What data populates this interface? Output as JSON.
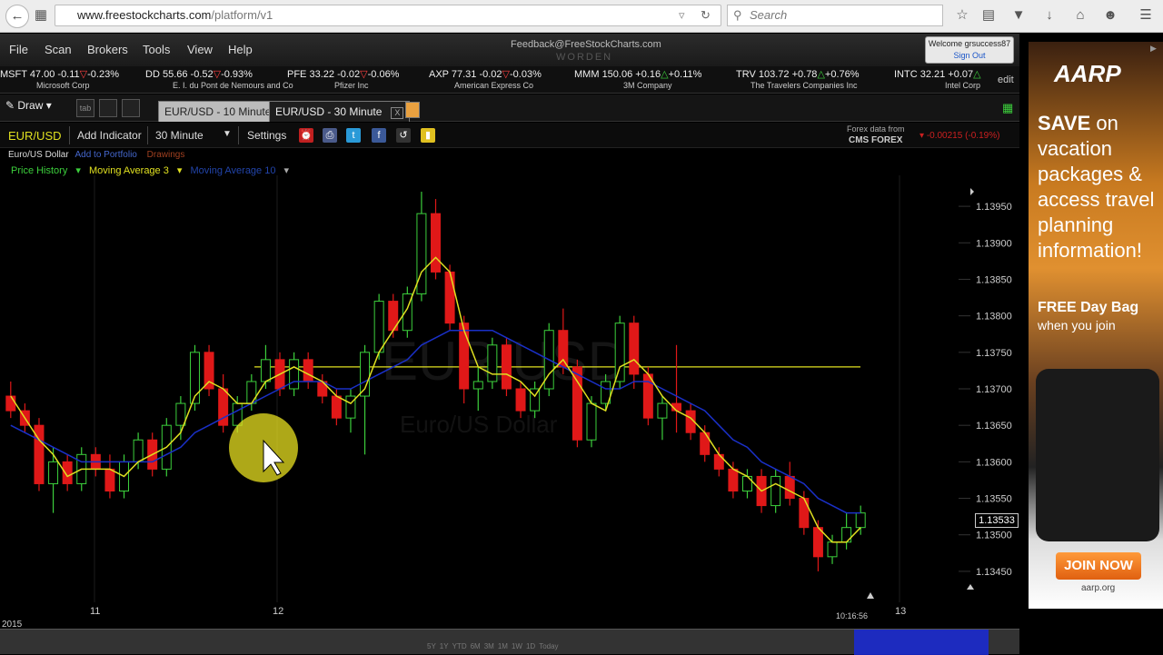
{
  "browser": {
    "url_host": "www.freestockcharts.com",
    "url_path": "/platform/v1",
    "search_placeholder": "Search"
  },
  "menu": {
    "items": [
      "File",
      "Scan",
      "Brokers",
      "Tools",
      "View",
      "Help"
    ],
    "feedback": "Feedback@FreeStockCharts.com",
    "worden": "WORDEN",
    "welcome": "Welcome grsuccess87",
    "sign_out": "Sign Out"
  },
  "ticker": {
    "items": [
      {
        "sym": "MSFT",
        "price": "47.00",
        "chg": "-0.11",
        "pct": "-0.23%",
        "dir": "down",
        "co": "Microsoft Corp"
      },
      {
        "sym": "DD",
        "price": "55.66",
        "chg": "-0.52",
        "pct": "-0.93%",
        "dir": "down",
        "co": "E. I. du Pont de Nemours and Co"
      },
      {
        "sym": "PFE",
        "price": "33.22",
        "chg": "-0.02",
        "pct": "-0.06%",
        "dir": "down",
        "co": "Pfizer Inc"
      },
      {
        "sym": "AXP",
        "price": "77.31",
        "chg": "-0.02",
        "pct": "-0.03%",
        "dir": "down",
        "co": "American Express Co"
      },
      {
        "sym": "MMM",
        "price": "150.06",
        "chg": "+0.16",
        "pct": "+0.11%",
        "dir": "up",
        "co": "3M Company"
      },
      {
        "sym": "TRV",
        "price": "103.72",
        "chg": "+0.78",
        "pct": "+0.76%",
        "dir": "up",
        "co": "The Travelers Companies Inc"
      },
      {
        "sym": "INTC",
        "price": "32.21",
        "chg": "+0.07",
        "pct": "",
        "dir": "up",
        "co": "Intel Corp"
      }
    ],
    "edit": "edit"
  },
  "toolbar": {
    "draw": "Draw",
    "tab_label": "tab",
    "tabs": [
      "EUR/USD - 10 Minute",
      "EUR/USD - 30 Minute"
    ],
    "tab_close": "X"
  },
  "chart_header": {
    "symbol": "EUR/USD",
    "add_indicator": "Add Indicator",
    "interval": "30 Minute",
    "settings": "Settings",
    "forex_from": "Forex data from",
    "provider": "CMS FOREX",
    "change": "-0.00215 (-0.19%)",
    "name": "Euro/US Dollar",
    "add_portfolio": "Add to Portfolio",
    "drawings": "Drawings"
  },
  "legend": {
    "price": "Price History",
    "ma3": "Moving Average 3",
    "ma10": "Moving Average 10"
  },
  "colors": {
    "up": "#3ccf3c",
    "down": "#e01818",
    "ma3": "#e0e020",
    "ma10": "#1a30c8",
    "hline": "#e0e020"
  },
  "chart_data": {
    "type": "candlestick",
    "ylim": [
      1.1342,
      1.1398
    ],
    "y_ticks": [
      "1.13950",
      "1.13900",
      "1.13850",
      "1.13800",
      "1.13750",
      "1.13700",
      "1.13650",
      "1.13600",
      "1.13550",
      "1.13500",
      "1.13450"
    ],
    "y_tick_values": [
      1.1395,
      1.139,
      1.1385,
      1.138,
      1.1375,
      1.137,
      1.1365,
      1.136,
      1.1355,
      1.135,
      1.1345
    ],
    "x_labels": [
      "11",
      "12",
      "13"
    ],
    "last_price": "1.13533",
    "horizontal_line": 1.1373,
    "candles": [
      [
        1.1369,
        1.1371,
        1.1366,
        1.1367
      ],
      [
        1.1367,
        1.1368,
        1.1364,
        1.1365
      ],
      [
        1.1365,
        1.1366,
        1.1356,
        1.1357
      ],
      [
        1.1357,
        1.1362,
        1.1353,
        1.136
      ],
      [
        1.136,
        1.1361,
        1.1356,
        1.1357
      ],
      [
        1.1357,
        1.1362,
        1.1356,
        1.1361
      ],
      [
        1.1361,
        1.1362,
        1.1358,
        1.1359
      ],
      [
        1.1359,
        1.1361,
        1.1355,
        1.1356
      ],
      [
        1.1356,
        1.1361,
        1.1355,
        1.136
      ],
      [
        1.136,
        1.1364,
        1.1359,
        1.1363
      ],
      [
        1.1363,
        1.1364,
        1.1358,
        1.1359
      ],
      [
        1.1359,
        1.1366,
        1.1358,
        1.1365
      ],
      [
        1.1365,
        1.1369,
        1.1363,
        1.1368
      ],
      [
        1.1368,
        1.1376,
        1.1367,
        1.1375
      ],
      [
        1.1375,
        1.1376,
        1.1369,
        1.137
      ],
      [
        1.137,
        1.1372,
        1.1364,
        1.1365
      ],
      [
        1.1365,
        1.1369,
        1.1364,
        1.1368
      ],
      [
        1.1368,
        1.1372,
        1.1367,
        1.1371
      ],
      [
        1.1371,
        1.1376,
        1.137,
        1.1374
      ],
      [
        1.1374,
        1.1375,
        1.1369,
        1.137
      ],
      [
        1.137,
        1.1375,
        1.1369,
        1.1374
      ],
      [
        1.1374,
        1.1375,
        1.137,
        1.1371
      ],
      [
        1.1371,
        1.1372,
        1.1368,
        1.1369
      ],
      [
        1.1369,
        1.137,
        1.1365,
        1.1366
      ],
      [
        1.1366,
        1.137,
        1.1364,
        1.1369
      ],
      [
        1.1369,
        1.1376,
        1.1361,
        1.1375
      ],
      [
        1.1375,
        1.1383,
        1.1374,
        1.1382
      ],
      [
        1.1382,
        1.1383,
        1.1377,
        1.1378
      ],
      [
        1.1378,
        1.1384,
        1.1377,
        1.1383
      ],
      [
        1.1383,
        1.1397,
        1.1382,
        1.1394
      ],
      [
        1.1394,
        1.1396,
        1.1385,
        1.1386
      ],
      [
        1.1386,
        1.1387,
        1.1378,
        1.1379
      ],
      [
        1.1379,
        1.138,
        1.1368,
        1.137
      ],
      [
        1.137,
        1.1373,
        1.1367,
        1.1371
      ],
      [
        1.1371,
        1.1377,
        1.137,
        1.1376
      ],
      [
        1.1376,
        1.1377,
        1.1369,
        1.137
      ],
      [
        1.137,
        1.1371,
        1.1366,
        1.1367
      ],
      [
        1.1367,
        1.1371,
        1.1366,
        1.137
      ],
      [
        1.137,
        1.1379,
        1.1369,
        1.1378
      ],
      [
        1.1378,
        1.1381,
        1.1372,
        1.1373
      ],
      [
        1.1373,
        1.1374,
        1.1362,
        1.1363
      ],
      [
        1.1363,
        1.1369,
        1.1362,
        1.1368
      ],
      [
        1.1368,
        1.1372,
        1.1367,
        1.1371
      ],
      [
        1.1371,
        1.138,
        1.137,
        1.1379
      ],
      [
        1.1379,
        1.138,
        1.137,
        1.1372
      ],
      [
        1.1372,
        1.1373,
        1.1365,
        1.1366
      ],
      [
        1.1366,
        1.1369,
        1.1363,
        1.1368
      ],
      [
        1.1368,
        1.1376,
        1.1364,
        1.1367
      ],
      [
        1.1367,
        1.1368,
        1.1363,
        1.1364
      ],
      [
        1.1364,
        1.1365,
        1.136,
        1.1361
      ],
      [
        1.1361,
        1.1362,
        1.1358,
        1.1359
      ],
      [
        1.1359,
        1.136,
        1.1355,
        1.1356
      ],
      [
        1.1356,
        1.1359,
        1.1355,
        1.1358
      ],
      [
        1.1358,
        1.1359,
        1.1353,
        1.1354
      ],
      [
        1.1354,
        1.1359,
        1.1353,
        1.1358
      ],
      [
        1.1358,
        1.136,
        1.1354,
        1.1355
      ],
      [
        1.1355,
        1.1356,
        1.135,
        1.1351
      ],
      [
        1.1351,
        1.1352,
        1.1345,
        1.1347
      ],
      [
        1.1347,
        1.135,
        1.1346,
        1.1349
      ],
      [
        1.1349,
        1.1353,
        1.1348,
        1.1351
      ],
      [
        1.1351,
        1.1354,
        1.135,
        1.1353
      ]
    ],
    "ma3": [
      1.1369,
      1.1366,
      1.1363,
      1.1361,
      1.1358,
      1.1359,
      1.1359,
      1.1359,
      1.1358,
      1.136,
      1.1361,
      1.1362,
      1.1364,
      1.1369,
      1.1371,
      1.137,
      1.1368,
      1.1368,
      1.1371,
      1.1372,
      1.1373,
      1.1372,
      1.1371,
      1.1369,
      1.1368,
      1.137,
      1.1375,
      1.1378,
      1.1381,
      1.1386,
      1.1388,
      1.1386,
      1.1378,
      1.1373,
      1.1372,
      1.1372,
      1.1371,
      1.1369,
      1.1372,
      1.1374,
      1.1371,
      1.1368,
      1.1367,
      1.1373,
      1.1374,
      1.1372,
      1.1369,
      1.1367,
      1.1366,
      1.1364,
      1.1361,
      1.1359,
      1.1358,
      1.1356,
      1.1357,
      1.1356,
      1.1355,
      1.1351,
      1.1349,
      1.1349,
      1.1351
    ],
    "ma10": [
      1.1365,
      1.1364,
      1.1363,
      1.1362,
      1.1361,
      1.136,
      1.136,
      1.136,
      1.136,
      1.136,
      1.136,
      1.1361,
      1.1362,
      1.1364,
      1.1365,
      1.1366,
      1.1367,
      1.1368,
      1.1369,
      1.137,
      1.1371,
      1.1371,
      1.1371,
      1.137,
      1.137,
      1.1371,
      1.1372,
      1.1373,
      1.1374,
      1.1376,
      1.1377,
      1.1378,
      1.1378,
      1.1378,
      1.1378,
      1.1377,
      1.1376,
      1.1375,
      1.1374,
      1.1373,
      1.1372,
      1.1371,
      1.137,
      1.137,
      1.1371,
      1.1371,
      1.137,
      1.1369,
      1.1368,
      1.1367,
      1.1365,
      1.1363,
      1.1362,
      1.136,
      1.1359,
      1.1358,
      1.1357,
      1.1355,
      1.1354,
      1.1353,
      1.1353
    ]
  },
  "axis": {
    "year": "2015",
    "time": "10:16:56"
  },
  "range_buttons": [
    "5Y",
    "1Y",
    "YTD",
    "6M",
    "3M",
    "1M",
    "1W",
    "1D",
    "Today"
  ],
  "ad": {
    "logo": "AARP",
    "line1": "SAVE",
    "line1b": "on",
    "line2": "vacation packages & access travel planning information!",
    "free": "FREE Day Bag",
    "join_you": "when you join",
    "cta": "JOIN NOW",
    "url": "aarp.org"
  }
}
